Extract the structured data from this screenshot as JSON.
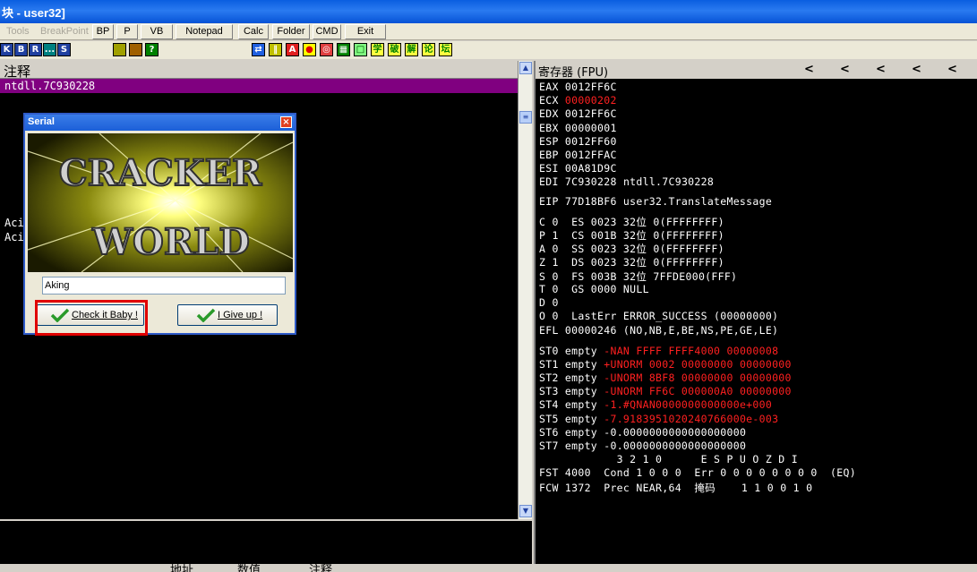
{
  "window": {
    "title": "块 - user32]"
  },
  "menu": {
    "tools": "Tools",
    "breakpoint": "BreakPoint",
    "buttons": [
      "BP",
      "P",
      "VB",
      "Notepad",
      "Calc",
      "Folder",
      "CMD",
      "Exit"
    ]
  },
  "iconbar": {
    "left": [
      "K",
      "B",
      "R",
      "...",
      "S"
    ],
    "chinese": [
      "学",
      "破",
      "解",
      "论",
      "坛"
    ]
  },
  "left_pane": {
    "header": "注释",
    "selected_row": "ntdll.7C930228",
    "rows": [
      "Aci",
      "Aci"
    ]
  },
  "dialog": {
    "title": "Serial",
    "logo_line1": "CRACKER",
    "logo_line2": "WORLD",
    "input_value": "Aking",
    "check_button": "Check it Baby !",
    "giveup_button": "I Give up !"
  },
  "registers": {
    "header": "寄存器 (FPU)",
    "arrows": [
      "<",
      "<",
      "<",
      "<",
      "<"
    ],
    "lines": [
      {
        "label": "EAX",
        "value": "0012FF6C",
        "extra": ""
      },
      {
        "label": "ECX",
        "value": "00000202",
        "extra": "",
        "red": true
      },
      {
        "label": "EDX",
        "value": "0012FF6C",
        "extra": ""
      },
      {
        "label": "EBX",
        "value": "00000001",
        "extra": ""
      },
      {
        "label": "ESP",
        "value": "0012FF60",
        "extra": ""
      },
      {
        "label": "EBP",
        "value": "0012FFAC",
        "extra": ""
      },
      {
        "label": "ESI",
        "value": "00A81D9C",
        "extra": ""
      },
      {
        "label": "EDI",
        "value": "7C930228",
        "extra": "ntdll.7C930228"
      }
    ],
    "eip": "EIP 77D18BF6 user32.TranslateMessage",
    "flags": [
      "C 0  ES 0023 32位 0(FFFFFFFF)",
      "P 1  CS 001B 32位 0(FFFFFFFF)",
      "A 0  SS 0023 32位 0(FFFFFFFF)",
      "Z 1  DS 0023 32位 0(FFFFFFFF)",
      "S 0  FS 003B 32位 7FFDE000(FFF)",
      "T 0  GS 0000 NULL",
      "D 0",
      "O 0  LastErr ERROR_SUCCESS (00000000)"
    ],
    "efl": "EFL 00000246 (NO,NB,E,BE,NS,PE,GE,LE)",
    "st": [
      {
        "label": "ST0 empty ",
        "value": "-NAN FFFF FFFF4000 00000008",
        "red": true
      },
      {
        "label": "ST1 empty ",
        "value": "+UNORM 0002 00000000 00000000",
        "red": true
      },
      {
        "label": "ST2 empty ",
        "value": "-UNORM 8BF8 00000000 00000000",
        "red": true
      },
      {
        "label": "ST3 empty ",
        "value": "-UNORM FF6C 000000A0 00000000",
        "red": true
      },
      {
        "label": "ST4 empty ",
        "value": "-1.#QNAN0000000000000e+000",
        "red": true
      },
      {
        "label": "ST5 empty ",
        "value": "-7.9183951020240766000e-003",
        "red": true
      },
      {
        "label": "ST6 empty ",
        "value": "-0.0000000000000000000",
        "red": false
      },
      {
        "label": "ST7 empty ",
        "value": "-0.0000000000000000000",
        "red": false
      }
    ],
    "fpu_header": "            3 2 1 0      E S P U O Z D I",
    "fst": "FST 4000  Cond 1 0 0 0  Err 0 0 0 0 0 0 0 0  (EQ)",
    "fcw": "FCW 1372  Prec NEAR,64  掩码    1 1 0 0 1 0"
  },
  "status": {
    "col1": "地址",
    "col2": "数值",
    "col3": "注释"
  },
  "colors": {
    "selection": "#800080",
    "highlight_box": "#e00000",
    "register_changed": "#ff2020"
  }
}
